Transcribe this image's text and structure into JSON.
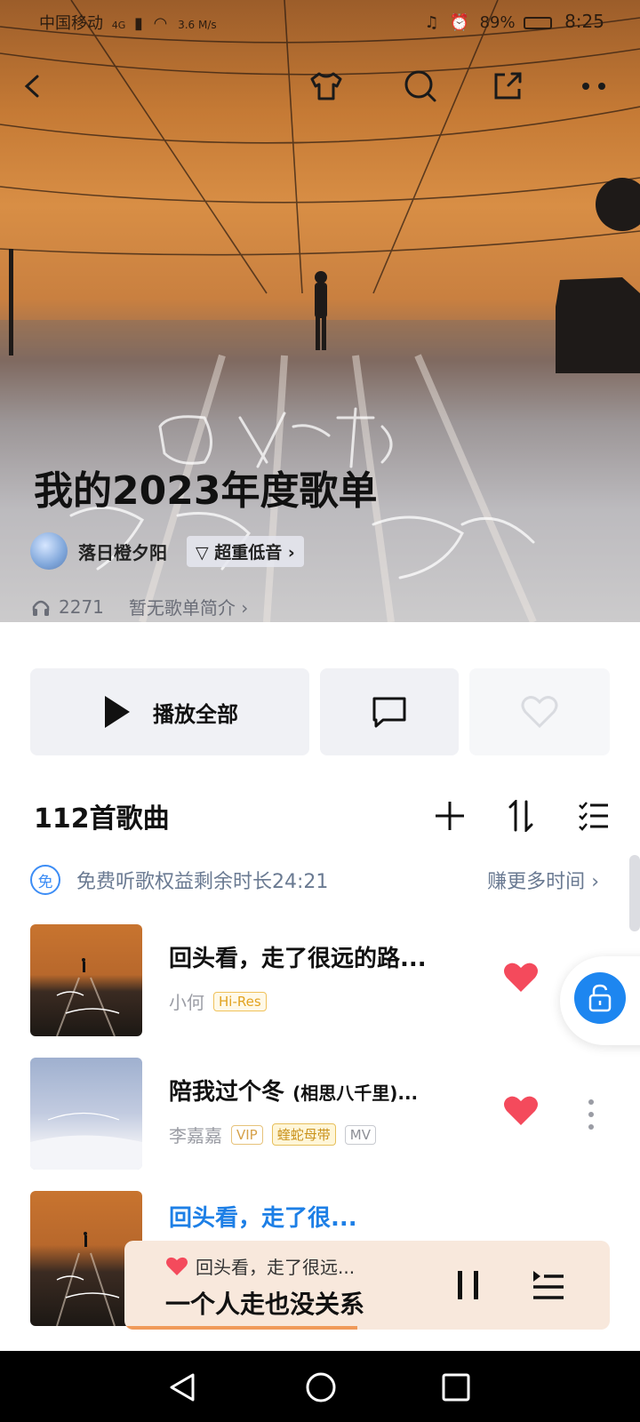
{
  "status_bar": {
    "carrier": "中国移动",
    "network": "4G",
    "speed": "3.6 M/s",
    "battery": "89%",
    "time": "8:25"
  },
  "playlist": {
    "title": "我的2023年度歌单",
    "owner": "落日橙夕阳",
    "owner_badge": "超重低音",
    "play_count": "2271",
    "intro": "暂无歌单简介"
  },
  "actions": {
    "play_all": "播放全部"
  },
  "list_header": {
    "count": "112首歌曲"
  },
  "free_banner": {
    "badge": "免",
    "text": "免费听歌权益剩余时长24:21",
    "link": "赚更多时间"
  },
  "songs": [
    {
      "title": "回头看，走了很远的路...",
      "subtitle": "",
      "artist": "小何",
      "tags": [
        "Hi-Res"
      ],
      "title_color": "#111111"
    },
    {
      "title": "陪我过个冬",
      "subtitle": "(相思八千里)...",
      "artist": "李嘉嘉",
      "tags": [
        "VIP",
        "蝰蛇母带",
        "MV"
      ],
      "title_color": "#111111"
    },
    {
      "title": "回头看，走了很...",
      "subtitle": "",
      "artist": "",
      "tags": [],
      "title_color": "#1d7fe6"
    }
  ],
  "now_playing": {
    "line1": "回头看，走了很远...",
    "line2": "一个人走也没关系",
    "progress": 0.48
  },
  "colors": {
    "accent_blue": "#1d86f0",
    "heart_red": "#f44a5c",
    "player_bg": "#f8e8dc"
  }
}
